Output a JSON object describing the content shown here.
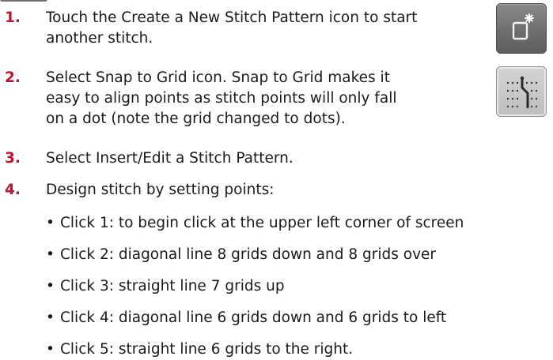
{
  "steps": [
    {
      "num": "1.",
      "line1": "Touch the Create a New Stitch Pattern icon to start",
      "line2": "another stitch."
    },
    {
      "num": "2.",
      "line1": "Select Snap to Grid icon. Snap to Grid makes it",
      "line2": "easy to align points as stitch points will only fall",
      "line3": "on a dot (note the grid changed to dots)."
    },
    {
      "num": "3.",
      "line1": "Select Insert/Edit a Stitch Pattern."
    },
    {
      "num": "4.",
      "line1": "Design stitch by setting points:"
    }
  ],
  "bullets": [
    "Click 1: to begin click at the upper left corner of screen",
    "Click 2: diagonal line 8 grids down and 8 grids over",
    "Click 3: straight line 7 grids up",
    "Click 4: diagonal line 6 grids down and 6 grids to left",
    "Click 5: straight line 6 grids to the right."
  ],
  "bullet_glyph": "•",
  "icons": {
    "new_pattern": "new-stitch-pattern-icon",
    "snap_to_grid": "snap-to-grid-icon"
  },
  "colors": {
    "step_number": "#c8102e",
    "text": "#1a1a1a",
    "icon_dark": "#6e6e6e",
    "icon_light": "#c9c9c9"
  }
}
